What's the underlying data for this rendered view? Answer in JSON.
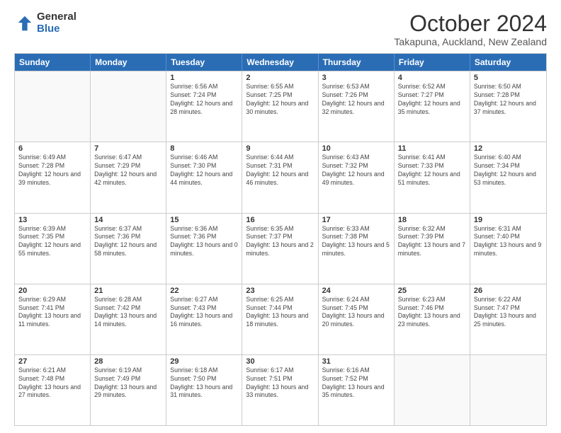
{
  "logo": {
    "general": "General",
    "blue": "Blue"
  },
  "title": "October 2024",
  "subtitle": "Takapuna, Auckland, New Zealand",
  "header_days": [
    "Sunday",
    "Monday",
    "Tuesday",
    "Wednesday",
    "Thursday",
    "Friday",
    "Saturday"
  ],
  "rows": [
    [
      {
        "day": "",
        "info": "",
        "empty": true
      },
      {
        "day": "",
        "info": "",
        "empty": true
      },
      {
        "day": "1",
        "info": "Sunrise: 6:56 AM\nSunset: 7:24 PM\nDaylight: 12 hours and 28 minutes."
      },
      {
        "day": "2",
        "info": "Sunrise: 6:55 AM\nSunset: 7:25 PM\nDaylight: 12 hours and 30 minutes."
      },
      {
        "day": "3",
        "info": "Sunrise: 6:53 AM\nSunset: 7:26 PM\nDaylight: 12 hours and 32 minutes."
      },
      {
        "day": "4",
        "info": "Sunrise: 6:52 AM\nSunset: 7:27 PM\nDaylight: 12 hours and 35 minutes."
      },
      {
        "day": "5",
        "info": "Sunrise: 6:50 AM\nSunset: 7:28 PM\nDaylight: 12 hours and 37 minutes."
      }
    ],
    [
      {
        "day": "6",
        "info": "Sunrise: 6:49 AM\nSunset: 7:28 PM\nDaylight: 12 hours and 39 minutes."
      },
      {
        "day": "7",
        "info": "Sunrise: 6:47 AM\nSunset: 7:29 PM\nDaylight: 12 hours and 42 minutes."
      },
      {
        "day": "8",
        "info": "Sunrise: 6:46 AM\nSunset: 7:30 PM\nDaylight: 12 hours and 44 minutes."
      },
      {
        "day": "9",
        "info": "Sunrise: 6:44 AM\nSunset: 7:31 PM\nDaylight: 12 hours and 46 minutes."
      },
      {
        "day": "10",
        "info": "Sunrise: 6:43 AM\nSunset: 7:32 PM\nDaylight: 12 hours and 49 minutes."
      },
      {
        "day": "11",
        "info": "Sunrise: 6:41 AM\nSunset: 7:33 PM\nDaylight: 12 hours and 51 minutes."
      },
      {
        "day": "12",
        "info": "Sunrise: 6:40 AM\nSunset: 7:34 PM\nDaylight: 12 hours and 53 minutes."
      }
    ],
    [
      {
        "day": "13",
        "info": "Sunrise: 6:39 AM\nSunset: 7:35 PM\nDaylight: 12 hours and 55 minutes."
      },
      {
        "day": "14",
        "info": "Sunrise: 6:37 AM\nSunset: 7:36 PM\nDaylight: 12 hours and 58 minutes."
      },
      {
        "day": "15",
        "info": "Sunrise: 6:36 AM\nSunset: 7:36 PM\nDaylight: 13 hours and 0 minutes."
      },
      {
        "day": "16",
        "info": "Sunrise: 6:35 AM\nSunset: 7:37 PM\nDaylight: 13 hours and 2 minutes."
      },
      {
        "day": "17",
        "info": "Sunrise: 6:33 AM\nSunset: 7:38 PM\nDaylight: 13 hours and 5 minutes."
      },
      {
        "day": "18",
        "info": "Sunrise: 6:32 AM\nSunset: 7:39 PM\nDaylight: 13 hours and 7 minutes."
      },
      {
        "day": "19",
        "info": "Sunrise: 6:31 AM\nSunset: 7:40 PM\nDaylight: 13 hours and 9 minutes."
      }
    ],
    [
      {
        "day": "20",
        "info": "Sunrise: 6:29 AM\nSunset: 7:41 PM\nDaylight: 13 hours and 11 minutes."
      },
      {
        "day": "21",
        "info": "Sunrise: 6:28 AM\nSunset: 7:42 PM\nDaylight: 13 hours and 14 minutes."
      },
      {
        "day": "22",
        "info": "Sunrise: 6:27 AM\nSunset: 7:43 PM\nDaylight: 13 hours and 16 minutes."
      },
      {
        "day": "23",
        "info": "Sunrise: 6:25 AM\nSunset: 7:44 PM\nDaylight: 13 hours and 18 minutes."
      },
      {
        "day": "24",
        "info": "Sunrise: 6:24 AM\nSunset: 7:45 PM\nDaylight: 13 hours and 20 minutes."
      },
      {
        "day": "25",
        "info": "Sunrise: 6:23 AM\nSunset: 7:46 PM\nDaylight: 13 hours and 23 minutes."
      },
      {
        "day": "26",
        "info": "Sunrise: 6:22 AM\nSunset: 7:47 PM\nDaylight: 13 hours and 25 minutes."
      }
    ],
    [
      {
        "day": "27",
        "info": "Sunrise: 6:21 AM\nSunset: 7:48 PM\nDaylight: 13 hours and 27 minutes."
      },
      {
        "day": "28",
        "info": "Sunrise: 6:19 AM\nSunset: 7:49 PM\nDaylight: 13 hours and 29 minutes."
      },
      {
        "day": "29",
        "info": "Sunrise: 6:18 AM\nSunset: 7:50 PM\nDaylight: 13 hours and 31 minutes."
      },
      {
        "day": "30",
        "info": "Sunrise: 6:17 AM\nSunset: 7:51 PM\nDaylight: 13 hours and 33 minutes."
      },
      {
        "day": "31",
        "info": "Sunrise: 6:16 AM\nSunset: 7:52 PM\nDaylight: 13 hours and 35 minutes."
      },
      {
        "day": "",
        "info": "",
        "empty": true
      },
      {
        "day": "",
        "info": "",
        "empty": true
      }
    ]
  ]
}
